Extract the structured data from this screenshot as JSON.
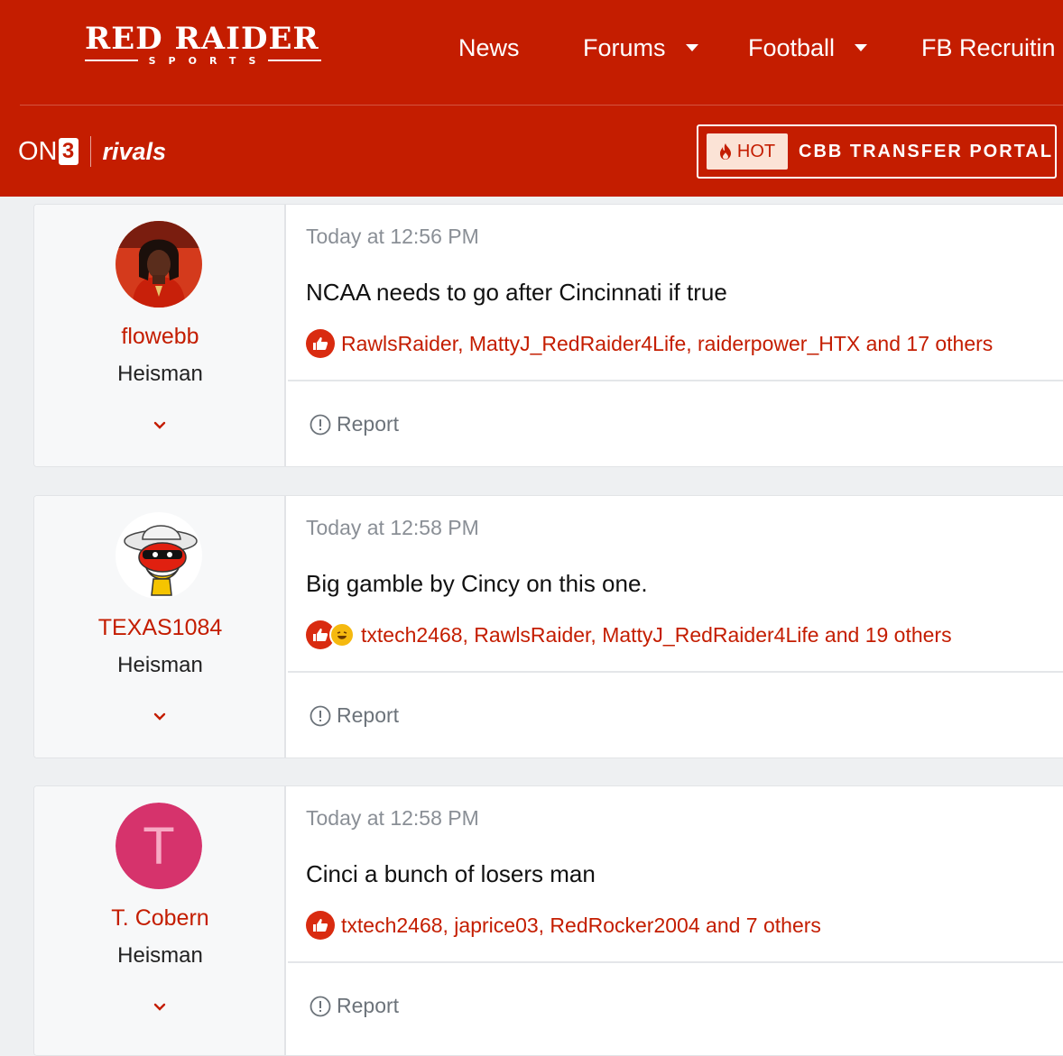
{
  "header": {
    "logo_title": "RED RAIDER",
    "logo_subtitle": "SPORTS",
    "nav": [
      {
        "label": "News"
      },
      {
        "label": "Forums"
      },
      {
        "label": "Football"
      },
      {
        "label": "FB Recruitin"
      }
    ],
    "on3_text": "ON",
    "on3_box": "3",
    "rivals_text": "rivals",
    "hot_badge": "HOT",
    "hot_label": "CBB TRANSFER PORTAL"
  },
  "posts": [
    {
      "username": "flowebb",
      "user_title": "Heisman",
      "time": "Today at 12:56 PM",
      "body": "NCAA needs to go after Cincinnati if true",
      "reactions": "RawlsRaider, MattyJ_RedRaider4Life, raiderpower_HTX and 17 others",
      "report": "Report"
    },
    {
      "username": "TEXAS1084",
      "user_title": "Heisman",
      "time": "Today at 12:58 PM",
      "body": "Big gamble by Cincy on this one.",
      "reactions": "txtech2468, RawlsRaider, MattyJ_RedRaider4Life and 19 others",
      "report": "Report"
    },
    {
      "username": "T. Cobern",
      "user_title": "Heisman",
      "avatar_letter": "T",
      "time": "Today at 12:58 PM",
      "body": "Cinci a bunch of losers man",
      "reactions": "txtech2468, japrice03, RedRocker2004 and 7 others",
      "report": "Report"
    }
  ],
  "colors": {
    "brand_red": "#c41d00",
    "avatar_pink": "#d6336c",
    "page_bg": "#eef0f2"
  }
}
